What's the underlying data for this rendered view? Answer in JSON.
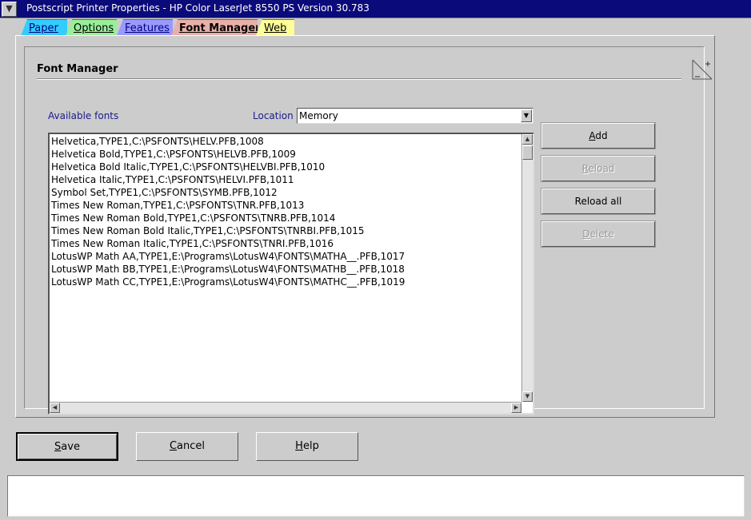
{
  "window": {
    "title": "Postscript Printer Properties - HP Color LaserJet 8550 PS Version 30.783"
  },
  "tabs": [
    {
      "label": "Paper"
    },
    {
      "label": "Options"
    },
    {
      "label": "Features"
    },
    {
      "label": "Font Manager",
      "selected": true
    },
    {
      "label": "Web"
    }
  ],
  "panel": {
    "heading": "Font Manager",
    "available_label": "Available fonts",
    "location_label": "Location",
    "location_value": "Memory"
  },
  "fonts": [
    "Helvetica,TYPE1,C:\\PSFONTS\\HELV.PFB,1008",
    "Helvetica Bold,TYPE1,C:\\PSFONTS\\HELVB.PFB,1009",
    "Helvetica Bold Italic,TYPE1,C:\\PSFONTS\\HELVBI.PFB,1010",
    "Helvetica Italic,TYPE1,C:\\PSFONTS\\HELVI.PFB,1011",
    "Symbol Set,TYPE1,C:\\PSFONTS\\SYMB.PFB,1012",
    "Times New Roman,TYPE1,C:\\PSFONTS\\TNR.PFB,1013",
    "Times New Roman Bold,TYPE1,C:\\PSFONTS\\TNRB.PFB,1014",
    "Times New Roman Bold Italic,TYPE1,C:\\PSFONTS\\TNRBI.PFB,1015",
    "Times New Roman Italic,TYPE1,C:\\PSFONTS\\TNRI.PFB,1016",
    "LotusWP Math AA,TYPE1,E:\\Programs\\LotusW4\\FONTS\\MATHA__.PFB,1017",
    "LotusWP Math BB,TYPE1,E:\\Programs\\LotusW4\\FONTS\\MATHB__.PFB,1018",
    "LotusWP Math CC,TYPE1,E:\\Programs\\LotusW4\\FONTS\\MATHC__.PFB,1019"
  ],
  "actions": {
    "add": "Add",
    "reload": "Reload",
    "reload_all": "Reload all",
    "delete": "Delete"
  },
  "footer": {
    "save": "Save",
    "cancel": "Cancel",
    "help": "Help",
    "status_text": ""
  }
}
